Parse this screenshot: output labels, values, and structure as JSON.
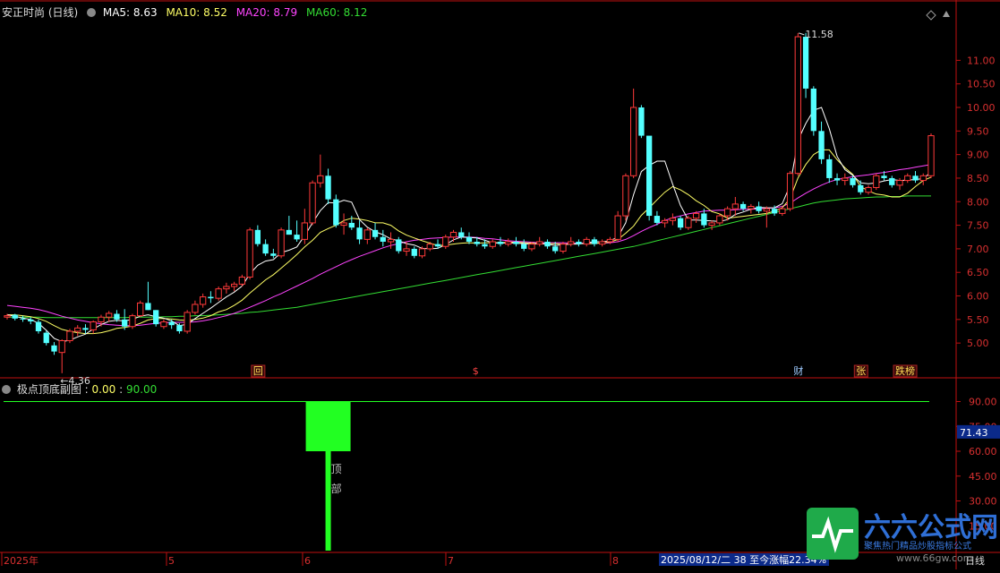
{
  "colors": {
    "up": "#ff3a3a",
    "down": "#54ffff",
    "ma5": "#ffffff",
    "ma10": "#ffff66",
    "ma20": "#ff44ff",
    "ma60": "#33dd33",
    "axis": "#c01010",
    "signal": "#22ff22",
    "price_tag": "#0b2a8a"
  },
  "header": {
    "stock": "安正时尚 (日线)",
    "ma5": "MA5: 8.63",
    "ma10": "MA10: 8.52",
    "ma20": "MA20: 8.79",
    "ma60": "MA60: 8.12"
  },
  "sub_header": {
    "name": "极点顶底副图",
    "v1": "0.00",
    "v2": "90.00"
  },
  "main_axis_labels": [
    "11.00",
    "10.50",
    "10.00",
    "9.50",
    "9.00",
    "8.50",
    "8.00",
    "7.50",
    "7.00",
    "6.50",
    "6.00",
    "5.50",
    "5.00"
  ],
  "sub_axis_labels": [
    "90.00",
    "75.00",
    "60.00",
    "45.00",
    "30.00",
    "15.00"
  ],
  "sub_price_tag": "71.43",
  "annotations": {
    "high": "11.58",
    "low": "4.36",
    "low_arrow": "←",
    "signal_text": "顶部"
  },
  "event_markers": [
    {
      "text": "回",
      "style": "box"
    },
    {
      "text": "$",
      "style": "plain"
    },
    {
      "text": "财",
      "style": "blue"
    },
    {
      "text": "张",
      "style": "box"
    },
    {
      "text": "跌榜",
      "style": "box"
    }
  ],
  "date_axis": [
    "2025年",
    "5",
    "6",
    "7",
    "8"
  ],
  "bottom_info": "2025/08/12/二 38 至今涨幅22.34%",
  "period_label": "日线",
  "watermark": {
    "brand": "六六公式网",
    "tagline": "聚焦热门精品炒股指标公式",
    "url": "www.66gw.com"
  },
  "chart_data": {
    "type": "candlestick",
    "ylim": [
      4.3,
      11.9
    ],
    "candles": [
      [
        5.55,
        5.62,
        5.5,
        5.58
      ],
      [
        5.6,
        5.62,
        5.48,
        5.52
      ],
      [
        5.52,
        5.58,
        5.45,
        5.5
      ],
      [
        5.5,
        5.55,
        5.4,
        5.46
      ],
      [
        5.45,
        5.5,
        5.2,
        5.25
      ],
      [
        5.22,
        5.26,
        4.95,
        5.0
      ],
      [
        4.95,
        5.02,
        4.75,
        4.82
      ],
      [
        4.8,
        5.08,
        4.36,
        5.05
      ],
      [
        5.05,
        5.3,
        5.0,
        5.25
      ],
      [
        5.25,
        5.38,
        5.15,
        5.32
      ],
      [
        5.32,
        5.4,
        5.2,
        5.28
      ],
      [
        5.28,
        5.48,
        5.2,
        5.45
      ],
      [
        5.45,
        5.6,
        5.35,
        5.55
      ],
      [
        5.55,
        5.68,
        5.45,
        5.63
      ],
      [
        5.62,
        5.7,
        5.45,
        5.5
      ],
      [
        5.5,
        5.72,
        5.28,
        5.35
      ],
      [
        5.35,
        5.62,
        5.3,
        5.58
      ],
      [
        5.58,
        5.9,
        5.55,
        5.85
      ],
      [
        5.85,
        6.3,
        5.7,
        5.7
      ],
      [
        5.7,
        5.7,
        5.35,
        5.4
      ],
      [
        5.35,
        5.5,
        5.3,
        5.45
      ],
      [
        5.45,
        5.5,
        5.3,
        5.38
      ],
      [
        5.38,
        5.42,
        5.2,
        5.25
      ],
      [
        5.25,
        5.7,
        5.2,
        5.65
      ],
      [
        5.65,
        5.9,
        5.6,
        5.82
      ],
      [
        5.82,
        6.05,
        5.75,
        5.98
      ],
      [
        5.98,
        6.1,
        5.85,
        5.95
      ],
      [
        5.95,
        6.2,
        5.9,
        6.15
      ],
      [
        6.15,
        6.28,
        6.05,
        6.2
      ],
      [
        6.2,
        6.3,
        6.1,
        6.25
      ],
      [
        6.25,
        6.45,
        6.2,
        6.4
      ],
      [
        6.4,
        7.45,
        6.35,
        7.4
      ],
      [
        7.4,
        7.5,
        7.05,
        7.1
      ],
      [
        7.1,
        7.2,
        6.85,
        6.9
      ],
      [
        6.9,
        7.0,
        6.8,
        6.85
      ],
      [
        6.85,
        7.45,
        6.8,
        7.4
      ],
      [
        7.4,
        7.7,
        7.3,
        7.3
      ],
      [
        7.3,
        7.6,
        7.15,
        7.2
      ],
      [
        7.2,
        7.85,
        7.1,
        7.55
      ],
      [
        7.55,
        8.45,
        7.5,
        8.4
      ],
      [
        8.4,
        9.0,
        8.3,
        8.55
      ],
      [
        8.55,
        8.7,
        7.95,
        8.05
      ],
      [
        8.05,
        8.15,
        7.45,
        7.5
      ],
      [
        7.5,
        7.75,
        7.3,
        7.55
      ],
      [
        7.55,
        7.7,
        7.4,
        7.45
      ],
      [
        7.45,
        7.6,
        7.1,
        7.2
      ],
      [
        7.2,
        7.45,
        7.1,
        7.4
      ],
      [
        7.4,
        7.55,
        7.2,
        7.25
      ],
      [
        7.25,
        7.4,
        7.05,
        7.15
      ],
      [
        7.15,
        7.35,
        7.0,
        7.2
      ],
      [
        7.2,
        7.25,
        6.9,
        6.95
      ],
      [
        6.95,
        7.15,
        6.85,
        7.0
      ],
      [
        7.0,
        7.05,
        6.8,
        6.85
      ],
      [
        6.85,
        7.05,
        6.8,
        7.0
      ],
      [
        7.0,
        7.15,
        6.95,
        7.1
      ],
      [
        7.1,
        7.2,
        7.0,
        7.05
      ],
      [
        7.05,
        7.3,
        7.0,
        7.25
      ],
      [
        7.25,
        7.4,
        7.15,
        7.35
      ],
      [
        7.35,
        7.45,
        7.2,
        7.25
      ],
      [
        7.25,
        7.35,
        7.1,
        7.15
      ],
      [
        7.15,
        7.25,
        7.05,
        7.1
      ],
      [
        7.1,
        7.2,
        7.0,
        7.05
      ],
      [
        7.05,
        7.2,
        7.0,
        7.15
      ],
      [
        7.15,
        7.25,
        7.05,
        7.1
      ],
      [
        7.1,
        7.22,
        7.05,
        7.15
      ],
      [
        7.15,
        7.25,
        7.05,
        7.1
      ],
      [
        7.1,
        7.2,
        6.95,
        7.0
      ],
      [
        7.0,
        7.15,
        6.95,
        7.1
      ],
      [
        7.1,
        7.25,
        7.05,
        7.15
      ],
      [
        7.15,
        7.2,
        7.0,
        7.05
      ],
      [
        7.05,
        7.15,
        6.9,
        6.95
      ],
      [
        6.95,
        7.15,
        6.9,
        7.1
      ],
      [
        7.1,
        7.25,
        7.05,
        7.15
      ],
      [
        7.15,
        7.2,
        7.05,
        7.1
      ],
      [
        7.1,
        7.25,
        7.05,
        7.2
      ],
      [
        7.2,
        7.25,
        7.05,
        7.1
      ],
      [
        7.1,
        7.2,
        7.05,
        7.15
      ],
      [
        7.15,
        7.25,
        7.1,
        7.2
      ],
      [
        7.2,
        7.8,
        7.15,
        7.7
      ],
      [
        7.7,
        8.6,
        7.6,
        8.55
      ],
      [
        8.55,
        10.4,
        8.5,
        10.0
      ],
      [
        10.0,
        10.05,
        9.35,
        9.4
      ],
      [
        9.4,
        7.8,
        7.6,
        7.7
      ],
      [
        7.7,
        7.8,
        7.5,
        7.55
      ],
      [
        7.55,
        7.65,
        7.45,
        7.6
      ],
      [
        7.6,
        7.75,
        7.5,
        7.65
      ],
      [
        7.65,
        7.7,
        7.4,
        7.45
      ],
      [
        7.45,
        7.7,
        7.4,
        7.65
      ],
      [
        7.65,
        7.8,
        7.55,
        7.75
      ],
      [
        7.75,
        7.85,
        7.45,
        7.5
      ],
      [
        7.5,
        7.6,
        7.4,
        7.55
      ],
      [
        7.55,
        7.75,
        7.5,
        7.7
      ],
      [
        7.7,
        7.9,
        7.6,
        7.85
      ],
      [
        7.85,
        8.1,
        7.7,
        7.95
      ],
      [
        7.95,
        8.0,
        7.8,
        7.85
      ],
      [
        7.85,
        7.95,
        7.75,
        7.9
      ],
      [
        7.9,
        8.0,
        7.75,
        7.8
      ],
      [
        7.8,
        7.9,
        7.45,
        7.85
      ],
      [
        7.85,
        7.92,
        7.7,
        7.75
      ],
      [
        7.75,
        7.9,
        7.7,
        7.85
      ],
      [
        7.85,
        8.65,
        7.8,
        8.6
      ],
      [
        8.6,
        11.58,
        8.55,
        11.5
      ],
      [
        11.5,
        11.58,
        10.2,
        10.4
      ],
      [
        10.4,
        10.45,
        9.4,
        9.5
      ],
      [
        9.5,
        9.7,
        8.8,
        8.9
      ],
      [
        8.9,
        9.0,
        8.4,
        8.5
      ],
      [
        8.5,
        8.6,
        8.35,
        8.45
      ],
      [
        8.45,
        8.6,
        8.35,
        8.5
      ],
      [
        8.5,
        8.55,
        8.3,
        8.35
      ],
      [
        8.35,
        8.45,
        8.15,
        8.2
      ],
      [
        8.2,
        8.35,
        8.15,
        8.3
      ],
      [
        8.3,
        8.6,
        8.25,
        8.55
      ],
      [
        8.55,
        8.65,
        8.45,
        8.5
      ],
      [
        8.5,
        8.55,
        8.3,
        8.35
      ],
      [
        8.35,
        8.5,
        8.25,
        8.45
      ],
      [
        8.45,
        8.6,
        8.4,
        8.55
      ],
      [
        8.55,
        8.65,
        8.4,
        8.45
      ],
      [
        8.45,
        8.6,
        8.35,
        8.55
      ],
      [
        8.55,
        9.45,
        8.5,
        9.4
      ]
    ],
    "ma5": [
      5.6,
      5.57,
      5.53,
      5.5,
      5.42,
      5.27,
      5.1,
      5.03,
      5.06,
      5.13,
      5.19,
      5.3,
      5.39,
      5.46,
      5.48,
      5.47,
      5.5,
      5.57,
      5.6,
      5.56,
      5.53,
      5.47,
      5.37,
      5.4,
      5.52,
      5.63,
      5.74,
      5.86,
      5.98,
      6.08,
      6.21,
      6.47,
      6.65,
      6.74,
      6.77,
      6.92,
      6.97,
      7.04,
      7.28,
      7.55,
      7.81,
      7.98,
      7.97,
      8.03,
      7.99,
      7.62,
      7.46,
      7.36,
      7.3,
      7.21,
      7.17,
      7.11,
      7.08,
      7.01,
      7.0,
      7.01,
      7.09,
      7.19,
      7.25,
      7.24,
      7.23,
      7.18,
      7.13,
      7.12,
      7.13,
      7.12,
      7.11,
      7.1,
      7.11,
      7.1,
      7.07,
      7.09,
      7.1,
      7.1,
      7.13,
      7.15,
      7.15,
      7.17,
      7.25,
      7.55,
      8.15,
      8.64,
      8.77,
      8.86,
      8.86,
      8.37,
      7.92,
      7.61,
      7.61,
      7.6,
      7.59,
      7.58,
      7.62,
      7.73,
      7.78,
      7.84,
      7.88,
      7.87,
      7.87,
      7.96,
      8.35,
      9.3,
      9.66,
      9.94,
      10.0,
      9.55,
      8.96,
      8.68,
      8.56,
      8.4,
      8.38,
      8.4,
      8.44,
      8.47,
      8.45,
      8.46,
      8.47,
      8.49,
      8.63
    ],
    "ma10": [
      5.6,
      5.6,
      5.58,
      5.56,
      5.52,
      5.46,
      5.37,
      5.29,
      5.25,
      5.22,
      5.2,
      5.2,
      5.22,
      5.26,
      5.31,
      5.33,
      5.36,
      5.42,
      5.49,
      5.52,
      5.52,
      5.51,
      5.49,
      5.48,
      5.5,
      5.53,
      5.58,
      5.66,
      5.71,
      5.8,
      5.91,
      6.06,
      6.2,
      6.34,
      6.45,
      6.59,
      6.73,
      6.88,
      7.04,
      7.18,
      7.35,
      7.43,
      7.5,
      7.6,
      7.65,
      7.63,
      7.6,
      7.55,
      7.55,
      7.5,
      7.38,
      7.29,
      7.23,
      7.17,
      7.12,
      7.07,
      7.08,
      7.1,
      7.12,
      7.13,
      7.12,
      7.13,
      7.13,
      7.13,
      7.14,
      7.14,
      7.13,
      7.12,
      7.11,
      7.11,
      7.11,
      7.1,
      7.1,
      7.11,
      7.11,
      7.11,
      7.13,
      7.14,
      7.2,
      7.33,
      7.48,
      7.71,
      7.87,
      8.04,
      8.2,
      8.32,
      8.25,
      8.15,
      8.02,
      7.92,
      7.79,
      7.74,
      7.65,
      7.67,
      7.69,
      7.71,
      7.73,
      7.75,
      7.8,
      7.87,
      8.07,
      8.5,
      8.79,
      9.0,
      9.1,
      9.1,
      8.89,
      8.72,
      8.58,
      8.32,
      8.23,
      8.16,
      8.14,
      8.1,
      8.1,
      8.18,
      8.32,
      8.45,
      8.52
    ],
    "ma20": [
      5.8,
      5.78,
      5.76,
      5.74,
      5.71,
      5.67,
      5.62,
      5.57,
      5.53,
      5.49,
      5.46,
      5.43,
      5.41,
      5.39,
      5.38,
      5.37,
      5.37,
      5.38,
      5.4,
      5.42,
      5.43,
      5.44,
      5.44,
      5.44,
      5.45,
      5.47,
      5.5,
      5.54,
      5.58,
      5.63,
      5.69,
      5.76,
      5.83,
      5.9,
      5.98,
      6.05,
      6.13,
      6.21,
      6.29,
      6.37,
      6.46,
      6.54,
      6.62,
      6.7,
      6.77,
      6.84,
      6.9,
      6.96,
      7.02,
      7.07,
      7.11,
      7.15,
      7.18,
      7.2,
      7.22,
      7.23,
      7.24,
      7.25,
      7.25,
      7.25,
      7.24,
      7.22,
      7.21,
      7.19,
      7.17,
      7.16,
      7.15,
      7.14,
      7.13,
      7.13,
      7.13,
      7.13,
      7.12,
      7.12,
      7.12,
      7.12,
      7.12,
      7.13,
      7.15,
      7.2,
      7.28,
      7.37,
      7.45,
      7.52,
      7.6,
      7.66,
      7.7,
      7.74,
      7.77,
      7.8,
      7.81,
      7.82,
      7.82,
      7.83,
      7.84,
      7.84,
      7.85,
      7.86,
      7.87,
      7.9,
      7.97,
      8.08,
      8.18,
      8.27,
      8.35,
      8.42,
      8.47,
      8.5,
      8.53,
      8.55,
      8.57,
      8.6,
      8.62,
      8.65,
      8.68,
      8.7,
      8.73,
      8.76,
      8.79
    ],
    "ma60": [
      5.55,
      5.55,
      5.55,
      5.55,
      5.55,
      5.54,
      5.54,
      5.54,
      5.54,
      5.54,
      5.54,
      5.54,
      5.54,
      5.54,
      5.54,
      5.54,
      5.55,
      5.55,
      5.55,
      5.55,
      5.56,
      5.56,
      5.57,
      5.57,
      5.58,
      5.58,
      5.59,
      5.6,
      5.61,
      5.62,
      5.63,
      5.65,
      5.66,
      5.68,
      5.7,
      5.72,
      5.74,
      5.76,
      5.79,
      5.82,
      5.85,
      5.88,
      5.91,
      5.94,
      5.97,
      6.0,
      6.03,
      6.06,
      6.09,
      6.12,
      6.15,
      6.18,
      6.21,
      6.24,
      6.27,
      6.3,
      6.33,
      6.36,
      6.39,
      6.42,
      6.45,
      6.48,
      6.51,
      6.54,
      6.57,
      6.6,
      6.63,
      6.66,
      6.69,
      6.72,
      6.75,
      6.78,
      6.81,
      6.84,
      6.87,
      6.9,
      6.93,
      6.96,
      6.99,
      7.02,
      7.05,
      7.09,
      7.13,
      7.17,
      7.21,
      7.25,
      7.29,
      7.33,
      7.37,
      7.41,
      7.45,
      7.49,
      7.53,
      7.57,
      7.61,
      7.65,
      7.69,
      7.73,
      7.77,
      7.81,
      7.85,
      7.89,
      7.93,
      7.97,
      8.0,
      8.02,
      8.04,
      8.06,
      8.07,
      8.08,
      8.09,
      8.1,
      8.1,
      8.11,
      8.11,
      8.12,
      8.12,
      8.12,
      8.12
    ],
    "sub_series": {
      "name": "极点顶底副图",
      "ylim": [
        0,
        100
      ],
      "line_value": 90,
      "signal": {
        "index": 41,
        "top": 90,
        "bottom": 60,
        "stem_bottom": 0
      }
    }
  }
}
